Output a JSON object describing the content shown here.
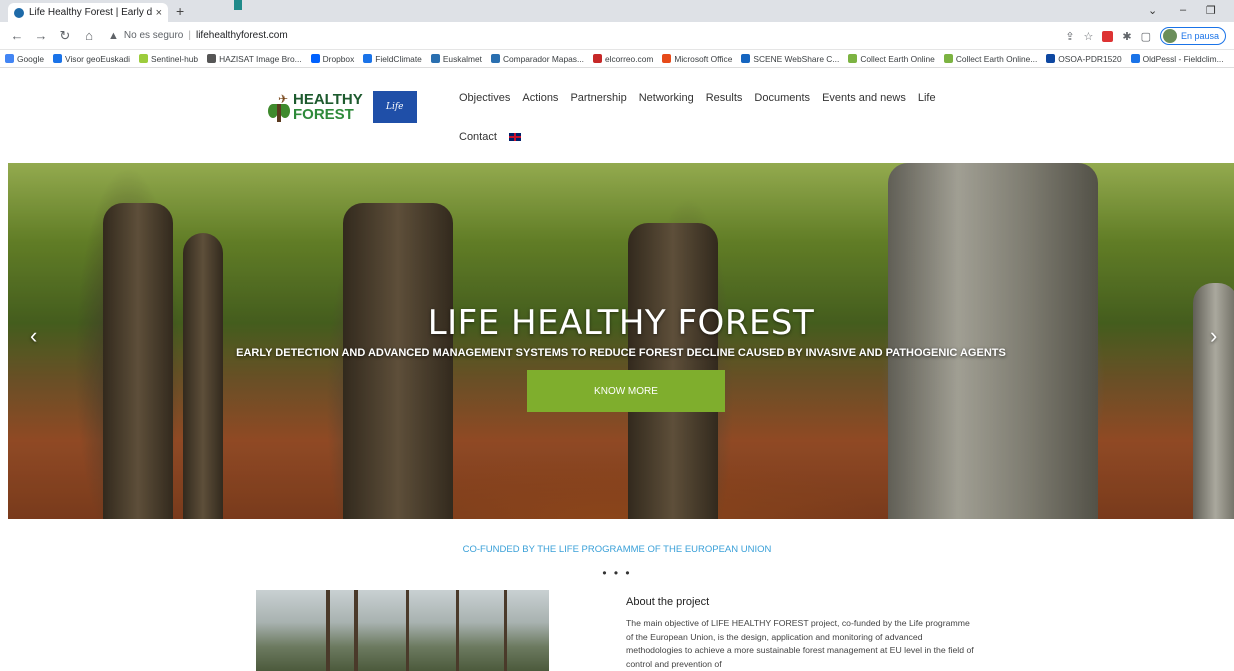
{
  "browser": {
    "tab_title": "Life Healthy Forest | Early detecti",
    "tab_close": "×",
    "new_tab": "+",
    "security_label": "No es seguro",
    "url": "lifehealthyforest.com",
    "profile_label": "En pausa",
    "bookmarks": [
      {
        "label": "Google",
        "color": "#4285f4"
      },
      {
        "label": "Visor geoEuskadi",
        "color": "#1a73e8"
      },
      {
        "label": "Sentinel-hub",
        "color": "#9ccc3c"
      },
      {
        "label": "HAZISAT Image Bro...",
        "color": "#555555"
      },
      {
        "label": "Dropbox",
        "color": "#0061fe"
      },
      {
        "label": "FieldClimate",
        "color": "#1a73e8"
      },
      {
        "label": "Euskalmet",
        "color": "#2a6fb0"
      },
      {
        "label": "Comparador Mapas...",
        "color": "#2a6fb0"
      },
      {
        "label": "elcorreo.com",
        "color": "#c62828"
      },
      {
        "label": "Microsoft Office",
        "color": "#e64a19"
      },
      {
        "label": "SCENE WebShare C...",
        "color": "#1565c0"
      },
      {
        "label": "Collect Earth Online",
        "color": "#7cb342"
      },
      {
        "label": "Collect Earth Online...",
        "color": "#7cb342"
      },
      {
        "label": "OSOA-PDR1520",
        "color": "#0d47a1"
      },
      {
        "label": "OldPessl - Fieldclim...",
        "color": "#1a73e8"
      }
    ]
  },
  "site": {
    "logo": {
      "line1": "HEALTHY",
      "line2": "FOREST",
      "eu_label": "Life"
    },
    "nav": [
      "Objectives",
      "Actions",
      "Partnership",
      "Networking",
      "Results",
      "Documents",
      "Events and news",
      "Life"
    ],
    "nav_contact": "Contact"
  },
  "hero": {
    "title": "LIFE HEALTHY FOREST",
    "subtitle": "EARLY DETECTION AND ADVANCED MANAGEMENT SYSTEMS TO REDUCE FOREST DECLINE CAUSED BY INVASIVE AND PATHOGENIC AGENTS",
    "button": "KNOW MORE",
    "prev": "‹",
    "next": "›"
  },
  "content": {
    "cofunded": "CO-FUNDED BY THE LIFE PROGRAMME OF THE EUROPEAN UNION",
    "dots": "• • •",
    "about_heading": "About the project",
    "about_text": "The main objective of LIFE HEALTHY FOREST project, co-funded by the Life programme of the European Union, is the design, application and monitoring of advanced methodologies to achieve a more sustainable forest management at EU level in the field of control and prevention of"
  }
}
